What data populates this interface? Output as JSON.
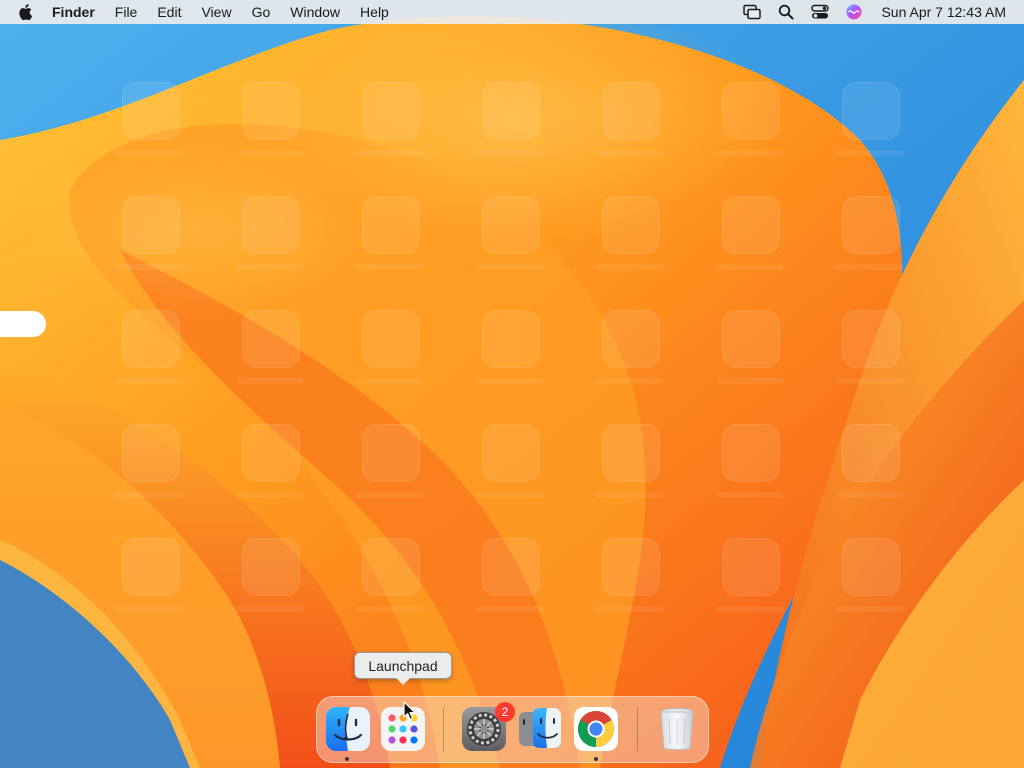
{
  "menubar": {
    "apple_icon": "apple-logo-icon",
    "app_name": "Finder",
    "menus": [
      "File",
      "Edit",
      "View",
      "Go",
      "Window",
      "Help"
    ],
    "status_icons": [
      "screen-mirroring-icon",
      "search-icon",
      "control-center-icon",
      "siri-icon"
    ],
    "clock": "Sun Apr 7  12:43 AM"
  },
  "tooltip": {
    "text": "Launchpad"
  },
  "dock": {
    "items": [
      {
        "name": "Finder",
        "icon": "finder-icon",
        "running": true
      },
      {
        "name": "Launchpad",
        "icon": "launchpad-icon",
        "running": false
      },
      {
        "name": "System Settings",
        "icon": "system-settings-icon",
        "running": false,
        "badge": "2"
      },
      {
        "name": "Migration Assistant",
        "icon": "migration-assistant-icon",
        "running": false
      },
      {
        "name": "Google Chrome",
        "icon": "chrome-icon",
        "running": true
      },
      {
        "name": "Trash",
        "icon": "trash-icon",
        "running": false
      }
    ]
  },
  "colors": {
    "wallpaper_blue": "#2b8fe0",
    "wallpaper_orange": "#ff8a1c",
    "wallpaper_deep_orange": "#f0561c",
    "badge_red": "#ff3b30",
    "menubar_bg": "#ececec"
  }
}
